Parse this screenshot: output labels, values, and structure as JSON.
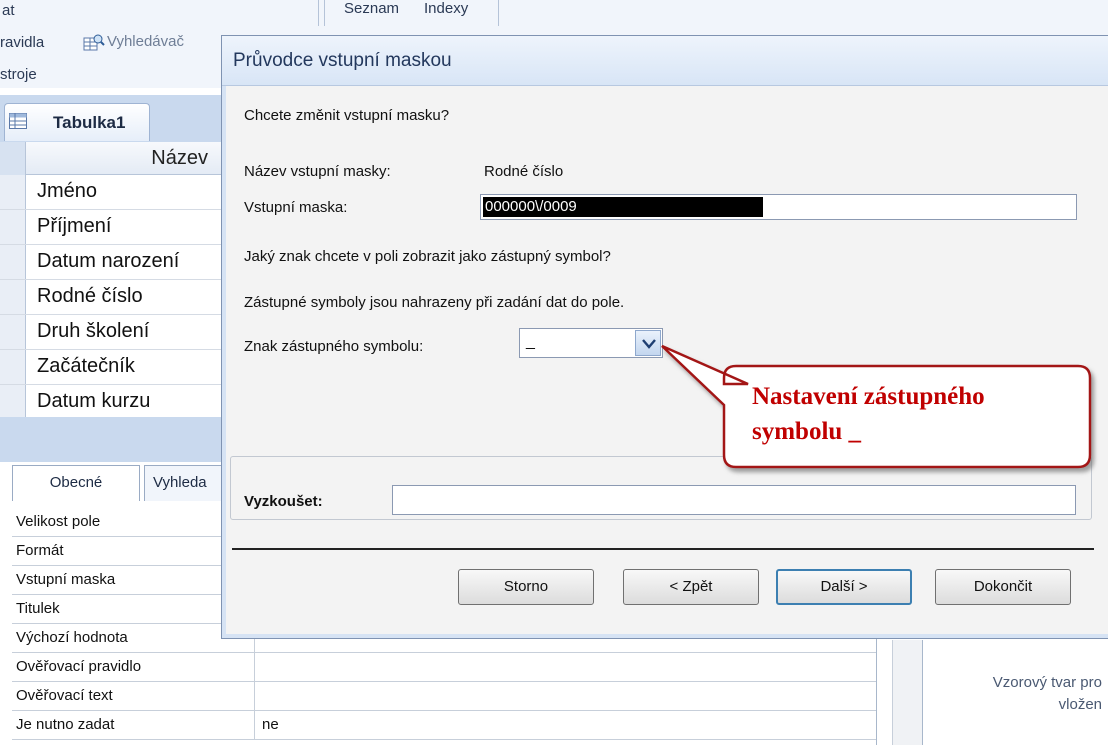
{
  "ribbon": {
    "label_at": "at",
    "label_pravidla": "ravidla",
    "label_vyhledavac": "Vyhledávač",
    "label_nastroje": "stroje",
    "label_seznam": "Seznam",
    "label_indexy": "Indexy"
  },
  "table_tab": {
    "label": "Tabulka1"
  },
  "grid": {
    "header": "Název",
    "fields": [
      "Jméno",
      "Příjmení",
      "Datum narození",
      "Rodné číslo",
      "Druh školení",
      "Začátečník",
      "Datum kurzu"
    ]
  },
  "properties": {
    "tabs": [
      "Obecné",
      "Vyhleda"
    ],
    "rows": [
      {
        "name": "Velikost pole",
        "value": ""
      },
      {
        "name": "Formát",
        "value": ""
      },
      {
        "name": "Vstupní maska",
        "value": ""
      },
      {
        "name": "Titulek",
        "value": ""
      },
      {
        "name": "Výchozí hodnota",
        "value": ""
      },
      {
        "name": "Ověřovací pravidlo",
        "value": ""
      },
      {
        "name": "Ověřovací text",
        "value": ""
      },
      {
        "name": "Je nutno zadat",
        "value": "ne"
      }
    ],
    "help_line1": "Vzorový tvar pro",
    "help_line2": "vložen"
  },
  "dialog": {
    "title": "Průvodce vstupní maskou",
    "question": "Chcete změnit vstupní masku?",
    "mask_name_label": "Název vstupní masky:",
    "mask_name_value": "Rodné číslo",
    "mask_label": "Vstupní maska:",
    "mask_value": "000000\\/0009",
    "placeholder_question": "Jaký znak chcete v poli zobrazit jako zástupný symbol?",
    "placeholder_info": "Zástupné symboly jsou nahrazeny při zadání dat do pole.",
    "placeholder_label": "Znak zástupného symbolu:",
    "placeholder_value": "_",
    "test_label": "Vyzkoušet:",
    "test_value": "",
    "buttons": {
      "cancel": "Storno",
      "back": "< Zpět",
      "next": "Další >",
      "finish": "Dokončit"
    }
  },
  "callout": {
    "line1": "Nastavení zástupného",
    "line2": "symbolu _",
    "color": "#c00000"
  }
}
